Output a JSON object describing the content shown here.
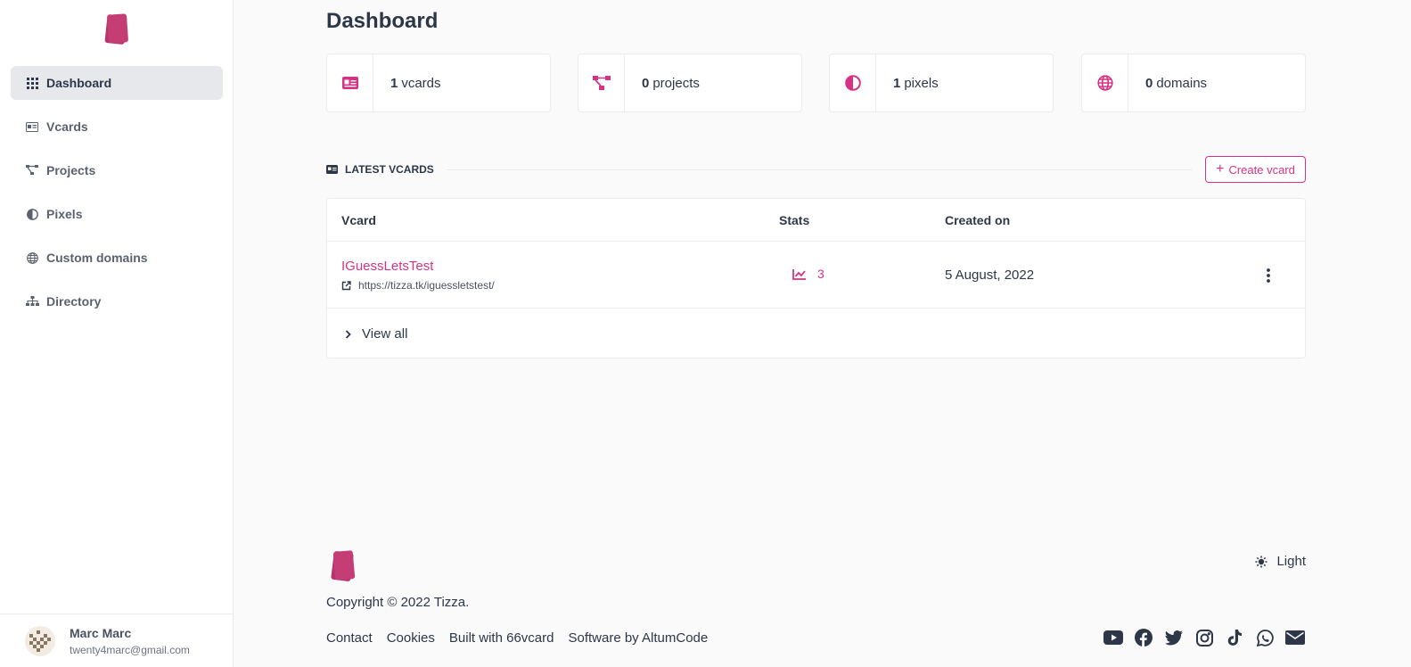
{
  "colors": {
    "accent": "#d63384",
    "logo": "#b8336a"
  },
  "sidebar": {
    "items": [
      {
        "label": "Dashboard",
        "icon": "grid-icon",
        "active": true
      },
      {
        "label": "Vcards",
        "icon": "id-card-icon"
      },
      {
        "label": "Projects",
        "icon": "project-diagram-icon"
      },
      {
        "label": "Pixels",
        "icon": "adjust-icon"
      },
      {
        "label": "Custom domains",
        "icon": "globe-icon"
      },
      {
        "label": "Directory",
        "icon": "sitemap-icon"
      }
    ],
    "user": {
      "name": "Marc Marc",
      "email": "twenty4marc@gmail.com"
    }
  },
  "main": {
    "title": "Dashboard",
    "stats": [
      {
        "count": "1",
        "label": "vcards",
        "icon": "id-card-icon"
      },
      {
        "count": "0",
        "label": "projects",
        "icon": "project-diagram-icon"
      },
      {
        "count": "1",
        "label": "pixels",
        "icon": "adjust-icon"
      },
      {
        "count": "0",
        "label": "domains",
        "icon": "globe-icon"
      }
    ],
    "latest": {
      "heading": "LATEST VCARDS",
      "create_label": "Create vcard",
      "columns": [
        "Vcard",
        "Stats",
        "Created on"
      ],
      "rows": [
        {
          "name": "IGuessLetsTest",
          "url": "https://tizza.tk/iguessletstest/",
          "stats": "3",
          "created": "5 August, 2022"
        }
      ],
      "view_all": "View all"
    }
  },
  "footer": {
    "copyright": "Copyright © 2022 Tizza.",
    "links": [
      "Contact",
      "Cookies",
      "Built with 66vcard",
      "Software by AltumCode"
    ],
    "theme_label": "Light",
    "socials": [
      "youtube-icon",
      "facebook-icon",
      "twitter-icon",
      "instagram-icon",
      "tiktok-icon",
      "whatsapp-icon",
      "mail-icon"
    ]
  }
}
